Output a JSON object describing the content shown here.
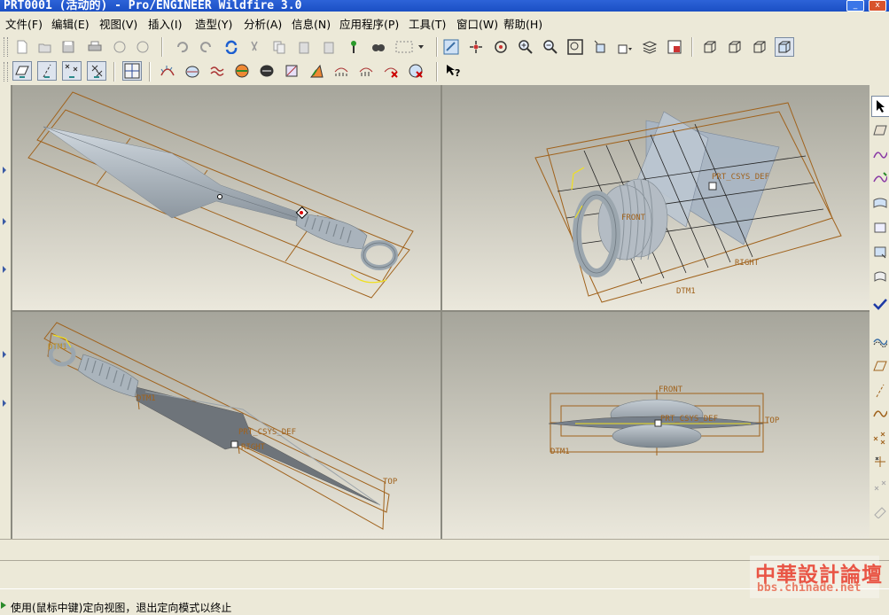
{
  "window": {
    "title": "PRT0001 (活动的) - Pro/ENGINEER Wildfire 3.0",
    "minimize": "_",
    "close": "x"
  },
  "menu": [
    {
      "label": "文件(F)"
    },
    {
      "label": "编辑(E)"
    },
    {
      "label": "视图(V)"
    },
    {
      "label": "插入(I)"
    },
    {
      "label": "造型(Y)"
    },
    {
      "label": "分析(A)"
    },
    {
      "label": "信息(N)"
    },
    {
      "label": "应用程序(P)"
    },
    {
      "label": "工具(T)"
    },
    {
      "label": "窗口(W)"
    },
    {
      "label": "帮助(H)"
    }
  ],
  "toolbar1_icons": [
    "new-file-icon",
    "open-icon",
    "save-icon",
    "print-icon",
    "send-mail-icon",
    "send-mail-alt-icon",
    "undo-icon",
    "redo-icon",
    "regenerate-icon",
    "cut-icon",
    "copy-icon",
    "paste-icon",
    "paste-special-icon",
    "model-player-icon",
    "find-icon",
    "selection-box-icon",
    "repaint-icon",
    "spin-center-icon",
    "orient-mode-icon",
    "zoom-in-icon",
    "zoom-out-icon",
    "refit-icon",
    "reorient-icon",
    "saved-views-icon",
    "layers-icon",
    "view-manager-icon",
    "wireframe-icon",
    "hidden-line-icon",
    "no-hidden-icon",
    "shading-icon"
  ],
  "toolbar2_icons": [
    "datum-planes-icon",
    "datum-axes-icon",
    "datum-points-icon",
    "coordinate-systems-icon",
    "four-view-icon",
    "curvature-icon",
    "section-icon",
    "offset-icon",
    "reflection-icon",
    "slope-icon",
    "draft-icon",
    "curve-analysis-icon",
    "connection-icon",
    "dihedral-icon",
    "delete-analysis-icon",
    "hide-analysis-icon",
    "whats-this-icon"
  ],
  "right_toolbar_icons": [
    "select-arrow-icon",
    "set-active-plane-icon",
    "curve-icon",
    "curve-on-surface-icon",
    "boundary-surface-icon",
    "surface-icon",
    "curve-edit-icon",
    "trim-icon",
    "done-check-icon",
    "offset-curve-icon",
    "plane-icon",
    "axis-icon",
    "curve-datum-icon",
    "point-icon",
    "coordinate-icon",
    "csys-offset-icon",
    "analysis-icon"
  ],
  "viewports": {
    "top_left": {
      "labels": []
    },
    "top_right": {
      "labels": [
        "PRT_CSYS_DEF",
        "FRONT",
        "RIGHT",
        "DTM1"
      ]
    },
    "bottom_left": {
      "labels": [
        "DTM1",
        "PRT_CSYS_DEF",
        "RIGHT",
        "TOP"
      ]
    },
    "bottom_right": {
      "labels": [
        "FRONT",
        "PRT_CSYS_DEF",
        "TOP",
        "DTM1"
      ]
    }
  },
  "status": {
    "message": "使用(鼠标中键)定向视图，退出定向模式以终止"
  },
  "watermark": {
    "cn": "中華設計論壇",
    "url": "bbs.chinade.net"
  },
  "colors": {
    "titlebar": "#1b4fc4",
    "frame_brown": "#a0621c",
    "model_gray": "#9aa5ae",
    "highlight_yellow": "#f0e020"
  }
}
